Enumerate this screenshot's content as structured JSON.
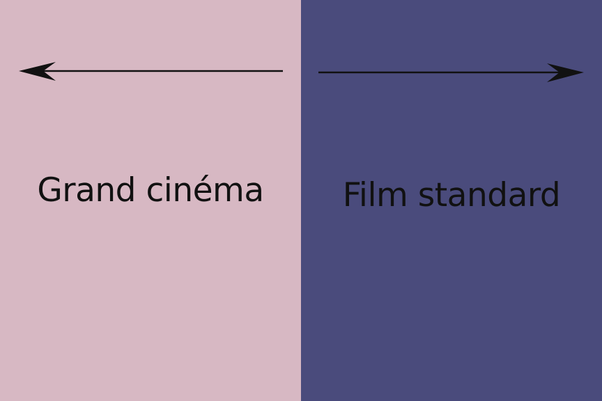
{
  "left_panel": {
    "label": "Grand cinéma",
    "background": "#d7b8c3",
    "arrow_direction": "left"
  },
  "right_panel": {
    "label": "Film standard",
    "background": "#4a4b7c",
    "arrow_direction": "right"
  },
  "text_color": "#111111"
}
